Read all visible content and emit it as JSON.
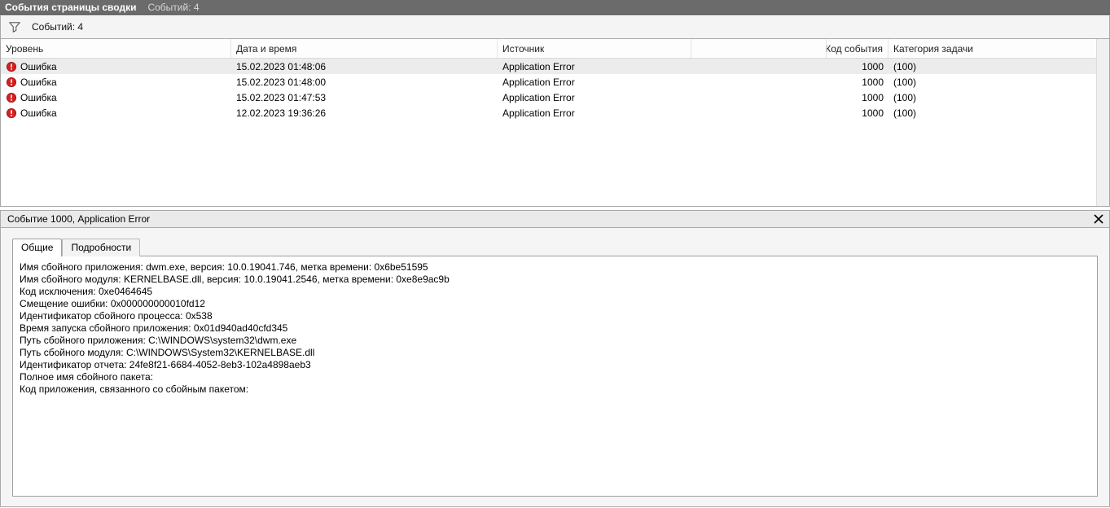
{
  "titlebar": {
    "title": "События страницы сводки",
    "subtitle": "Событий: 4"
  },
  "filterbar": {
    "count_label": "Событий: 4"
  },
  "columns": {
    "level": "Уровень",
    "datetime": "Дата и время",
    "source": "Источник",
    "eventid": "Код события",
    "category": "Категория задачи"
  },
  "rows": [
    {
      "level": "Ошибка",
      "datetime": "15.02.2023 01:48:06",
      "source": "Application Error",
      "eventid": "1000",
      "category": "(100)",
      "selected": true
    },
    {
      "level": "Ошибка",
      "datetime": "15.02.2023 01:48:00",
      "source": "Application Error",
      "eventid": "1000",
      "category": "(100)",
      "selected": false
    },
    {
      "level": "Ошибка",
      "datetime": "15.02.2023 01:47:53",
      "source": "Application Error",
      "eventid": "1000",
      "category": "(100)",
      "selected": false
    },
    {
      "level": "Ошибка",
      "datetime": "12.02.2023 19:36:26",
      "source": "Application Error",
      "eventid": "1000",
      "category": "(100)",
      "selected": false
    }
  ],
  "detail": {
    "header": "Событие 1000, Application Error",
    "tabs": {
      "general": "Общие",
      "details": "Подробности"
    },
    "body_lines": [
      "Имя сбойного приложения: dwm.exe, версия: 10.0.19041.746, метка времени: 0x6be51595",
      "Имя сбойного модуля: KERNELBASE.dll, версия: 10.0.19041.2546, метка времени: 0xe8e9ac9b",
      "Код исключения: 0xe0464645",
      "Смещение ошибки: 0x000000000010fd12",
      "Идентификатор сбойного процесса: 0x538",
      "Время запуска сбойного приложения: 0x01d940ad40cfd345",
      "Путь сбойного приложения: C:\\WINDOWS\\system32\\dwm.exe",
      "Путь сбойного модуля: C:\\WINDOWS\\System32\\KERNELBASE.dll",
      "Идентификатор отчета: 24fe8f21-6684-4052-8eb3-102a4898aeb3",
      "Полное имя сбойного пакета:",
      "Код приложения, связанного со сбойным пакетом:"
    ]
  }
}
